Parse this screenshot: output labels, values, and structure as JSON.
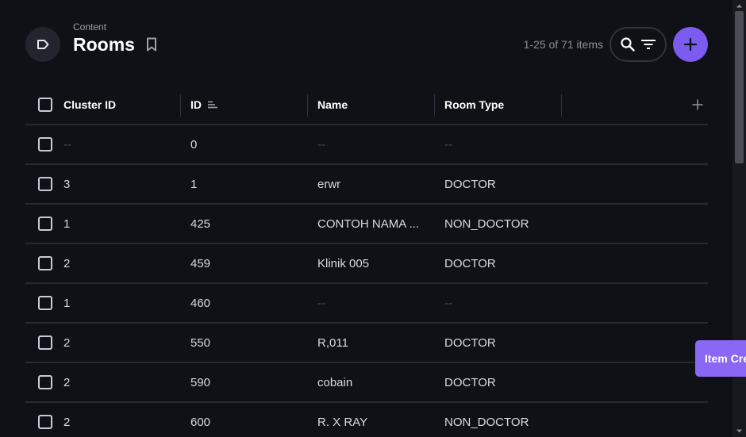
{
  "header": {
    "breadcrumb": "Content",
    "title": "Rooms",
    "count": "1-25 of 71 items"
  },
  "table": {
    "columns": {
      "cluster_id": "Cluster ID",
      "id": "ID",
      "name": "Name",
      "room_type": "Room Type"
    },
    "rows": [
      {
        "cluster_id": "--",
        "id": "0",
        "name": "--",
        "room_type": "--"
      },
      {
        "cluster_id": "3",
        "id": "1",
        "name": "erwr",
        "room_type": "DOCTOR"
      },
      {
        "cluster_id": "1",
        "id": "425",
        "name": "CONTOH NAMA ...",
        "room_type": "NON_DOCTOR"
      },
      {
        "cluster_id": "2",
        "id": "459",
        "name": "Klinik 005",
        "room_type": "DOCTOR"
      },
      {
        "cluster_id": "1",
        "id": "460",
        "name": "--",
        "room_type": "--"
      },
      {
        "cluster_id": "2",
        "id": "550",
        "name": "R,011",
        "room_type": "DOCTOR"
      },
      {
        "cluster_id": "2",
        "id": "590",
        "name": "cobain",
        "room_type": "DOCTOR"
      },
      {
        "cluster_id": "2",
        "id": "600",
        "name": "R. X RAY",
        "room_type": "NON_DOCTOR"
      }
    ]
  },
  "toast": {
    "text": "Item Cre"
  },
  "colors": {
    "background": "#0f1116",
    "accent": "#7c5cf0",
    "toast": "#8a68f5"
  },
  "icons": {
    "nav": "label-tag-icon",
    "bookmark": "bookmark-icon",
    "search": "search-icon",
    "filter": "filter-icon",
    "add": "plus-icon",
    "sort": "sort-icon",
    "add_column": "plus-icon"
  }
}
